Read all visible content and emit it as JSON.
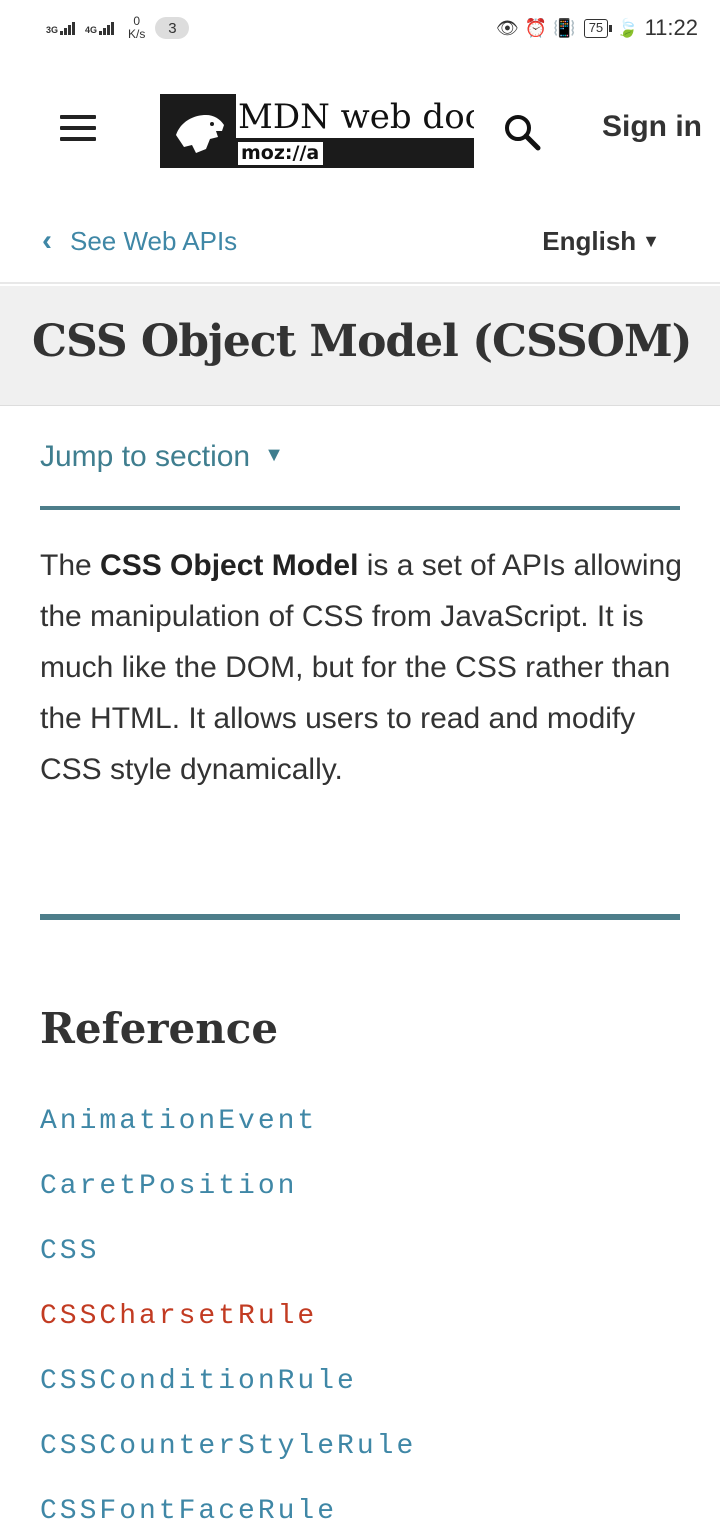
{
  "status_bar": {
    "sig1": "3G",
    "sig2": "4G",
    "net_value": "0",
    "net_unit": "K/s",
    "notif_count": "3",
    "battery": "75",
    "time": "11:22"
  },
  "header": {
    "logo_title": "MDN web docs",
    "logo_sub": "moz://a",
    "signin_label": "Sign in"
  },
  "breadcrumb": {
    "back_label": "See Web APIs",
    "language": "English"
  },
  "page": {
    "title": "CSS Object Model (CSSOM)",
    "jump_label": "Jump to section",
    "intro_pre": "The ",
    "intro_bold": "CSS Object Model",
    "intro_post": " is a set of APIs allowing the manipulation of CSS from JavaScript. It is much like the DOM, but for the CSS rather than the HTML. It allows users to read and modify CSS style dynamically.",
    "reference_heading": "Reference"
  },
  "reference_items": [
    {
      "label": "AnimationEvent",
      "missing": false
    },
    {
      "label": "CaretPosition",
      "missing": false
    },
    {
      "label": "CSS",
      "missing": false
    },
    {
      "label": "CSSCharsetRule",
      "missing": true
    },
    {
      "label": "CSSConditionRule",
      "missing": false
    },
    {
      "label": "CSSCounterStyleRule",
      "missing": false
    },
    {
      "label": "CSSFontFaceRule",
      "missing": false
    }
  ],
  "colors": {
    "link": "#3f87a6",
    "missing_link": "#c23b22",
    "accent_rule": "#4d7e8a",
    "title_band": "#f0f0f0"
  }
}
